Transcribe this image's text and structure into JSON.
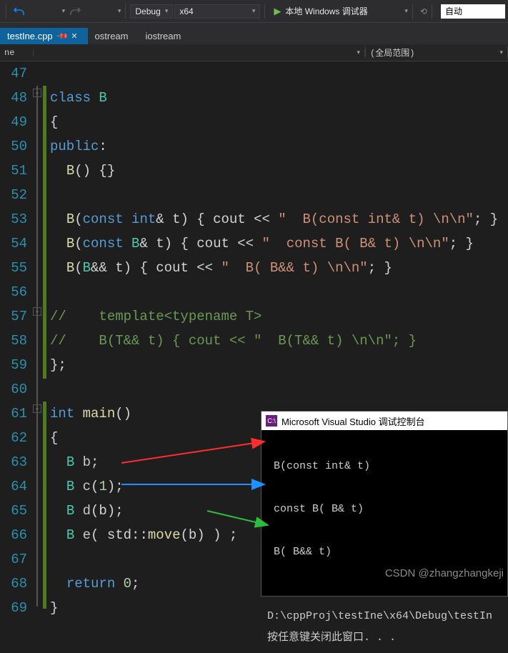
{
  "toolbar": {
    "config": "Debug",
    "platform": "x64",
    "debugger": "本地 Windows 调试器",
    "auto": "自动"
  },
  "tabs": {
    "active": "testIne.cpp",
    "t1": "ostream",
    "t2": "iostream"
  },
  "scope": {
    "left": "ne",
    "right": "(全局范围)"
  },
  "lines": {
    "start": 47,
    "end": 69
  },
  "code": {
    "l47": "",
    "l48_class": "class",
    "l48_B": "B",
    "l49": "{",
    "l50_public": "public",
    "l50_colon": ":",
    "l51_B": "B",
    "l51_body": "() {}",
    "l52": "",
    "l53_B": "B",
    "l53_sig1": "(",
    "l53_const": "const",
    "l53_int": "int",
    "l53_sig2": "& t) { cout << ",
    "l53_str": "\"  B(const int& t) \\n\\n\"",
    "l53_end": "; }",
    "l54_B": "B",
    "l54_sig1": "(",
    "l54_const": "const",
    "l54_Bt": "B",
    "l54_sig2": "& t) { cout << ",
    "l54_str": "\"  const B( B& t) \\n\\n\"",
    "l54_end": "; }",
    "l55_B": "B",
    "l55_sig1": "(",
    "l55_Bt": "B",
    "l55_sig2": "&& t) { cout << ",
    "l55_str": "\"  B( B&& t) \\n\\n\"",
    "l55_end": "; }",
    "l56": "",
    "l57": "//    template<typename T>",
    "l58": "//    B(T&& t) { cout << \"  B(T&& t) \\n\\n\"; }",
    "l59": "};",
    "l60": "",
    "l61_int": "int",
    "l61_main": "main",
    "l61_paren": "()",
    "l62": "{",
    "l63_B": "B",
    "l63_b": " b;",
    "l64_B": "B",
    "l64_c": " c",
    "l64_paren": "(",
    "l64_n": "1",
    "l64_end": ");",
    "l65_B": "B",
    "l65_d": " d",
    "l65_rest": "(b);",
    "l66_B": "B",
    "l66_e": " e",
    "l66_p1": "( std::",
    "l66_move": "move",
    "l66_p2": "(b) ) ;",
    "l67": "",
    "l68_ret": "return",
    "l68_sp": " ",
    "l68_n": "0",
    "l68_sc": ";",
    "l69": "}"
  },
  "console": {
    "title": "Microsoft Visual Studio 调试控制台",
    "l1": " B(const int& t)",
    "l2": " const B( B& t)",
    "l3": " B( B&& t)",
    "path": "D:\\cppProj\\testIne\\x64\\Debug\\testIn",
    "press": "按任意键关闭此窗口. . ."
  },
  "watermark": "CSDN @zhangzhangkeji"
}
